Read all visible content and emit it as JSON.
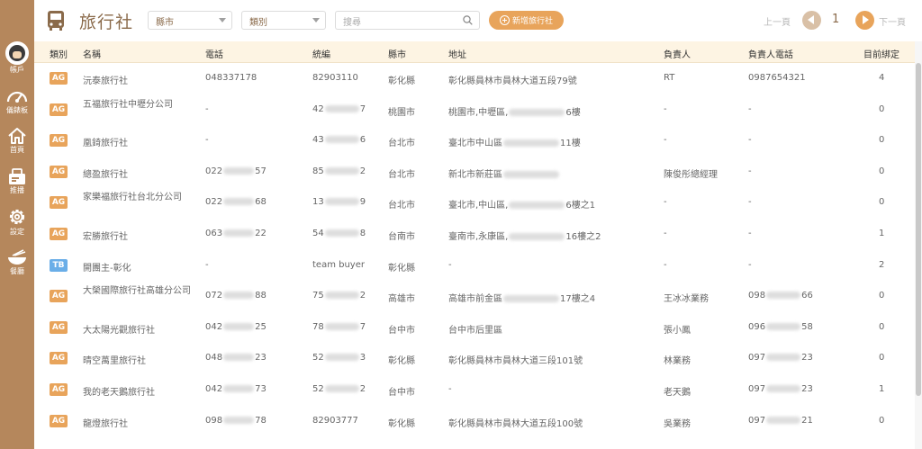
{
  "sidebar": {
    "items": [
      {
        "label": "帳戶",
        "icon": "avatar"
      },
      {
        "label": "儀錶板",
        "icon": "dashboard-icon"
      },
      {
        "label": "首頁",
        "icon": "home-icon"
      },
      {
        "label": "推播",
        "icon": "push-icon"
      },
      {
        "label": "設定",
        "icon": "gear-icon"
      },
      {
        "label": "餐廳",
        "icon": "restaurant-icon"
      }
    ]
  },
  "header": {
    "title": "旅行社",
    "county_select": "縣市",
    "category_select": "類別",
    "search_placeholder": "搜尋",
    "add_button": "新增旅行社",
    "prev_label": "上一頁",
    "page": "1",
    "next_label": "下一頁"
  },
  "table": {
    "columns": [
      "類別",
      "名稱",
      "電話",
      "統編",
      "縣市",
      "地址",
      "負責人",
      "負責人電話",
      "目前綁定"
    ],
    "rows": [
      {
        "tag": "AG",
        "name": "沅泰旅行社",
        "phone": "048337178",
        "tax": "82903110",
        "county": "彰化縣",
        "addr": "彰化縣員林市員林大道五段79號",
        "owner": "RT",
        "owner_phone": "0987654321",
        "bound": "4"
      },
      {
        "tag": "AG",
        "name": "五福旅行社中壢分公司",
        "phone": "-",
        "tax": "42",
        "tax_tail": "7",
        "county": "桃園市",
        "addr": "桃園市,中壢區,",
        "addr_tail": "6樓",
        "owner": "-",
        "owner_phone": "-",
        "bound": "0"
      },
      {
        "tag": "AG",
        "name": "凰錡旅行社",
        "phone": "-",
        "tax": "43",
        "tax_tail": "6",
        "county": "台北市",
        "addr": "臺北市中山區",
        "addr_tail": "11樓",
        "owner": "-",
        "owner_phone": "-",
        "bound": "0"
      },
      {
        "tag": "AG",
        "name": "總盈旅行社",
        "phone": "022",
        "phone_tail": "57",
        "tax": "85",
        "tax_tail": "2",
        "county": "台北市",
        "addr": "新北市新莊區",
        "addr_tail": "",
        "owner": "陳俊彤總經理",
        "owner_phone": "-",
        "bound": "0"
      },
      {
        "tag": "AG",
        "name": "家樂福旅行社台北分公司",
        "phone": "022",
        "phone_tail": "68",
        "tax": "13",
        "tax_tail": "9",
        "county": "台北市",
        "addr": "臺北市,中山區,",
        "addr_tail": "6樓之1",
        "owner": "-",
        "owner_phone": "-",
        "bound": "0"
      },
      {
        "tag": "AG",
        "name": "宏勝旅行社",
        "phone": "063",
        "phone_tail": "22",
        "tax": "54",
        "tax_tail": "8",
        "county": "台南市",
        "addr": "臺南市,永康區,",
        "addr_tail": "16樓之2",
        "owner": "-",
        "owner_phone": "-",
        "bound": "1"
      },
      {
        "tag": "TB",
        "name": "開團主-彰化",
        "phone": "-",
        "tax": "team buyer",
        "county": "彰化縣",
        "addr": "-",
        "owner": "-",
        "owner_phone": "-",
        "bound": "2"
      },
      {
        "tag": "AG",
        "name": "大榮國際旅行社高雄分公司",
        "phone": "072",
        "phone_tail": "88",
        "tax": "75",
        "tax_tail": "2",
        "county": "高雄市",
        "addr": "高雄市前金區",
        "addr_tail": "17樓之4",
        "owner": "王冰冰業務",
        "owner_phone": "098",
        "owner_phone_tail": "66",
        "bound": "0"
      },
      {
        "tag": "AG",
        "name": "大太陽光觀旅行社",
        "phone": "042",
        "phone_tail": "25",
        "tax": "78",
        "tax_tail": "7",
        "county": "台中市",
        "addr": "台中市后里區",
        "owner": "張小鳳",
        "owner_phone": "096",
        "owner_phone_tail": "58",
        "bound": "0"
      },
      {
        "tag": "AG",
        "name": "晴空萬里旅行社",
        "phone": "048",
        "phone_tail": "23",
        "tax": "52",
        "tax_tail": "3",
        "county": "彰化縣",
        "addr": "彰化縣員林市員林大道三段101號",
        "owner": "林業務",
        "owner_phone": "097",
        "owner_phone_tail": "23",
        "bound": "0"
      },
      {
        "tag": "AG",
        "name": "我的老天鵝旅行社",
        "phone": "042",
        "phone_tail": "73",
        "tax": "52",
        "tax_tail": "2",
        "county": "台中市",
        "addr": "-",
        "owner": "老天鵝",
        "owner_phone": "097",
        "owner_phone_tail": "23",
        "bound": "1"
      },
      {
        "tag": "AG",
        "name": "龍燈旅行社",
        "phone": "098",
        "phone_tail": "78",
        "tax": "82903777",
        "county": "彰化縣",
        "addr": "彰化縣員林市員林大道五段100號",
        "owner": "吳業務",
        "owner_phone": "097",
        "owner_phone_tail": "21",
        "bound": "0"
      }
    ]
  },
  "colors": {
    "sidebar": "#b5875c",
    "accent": "#e8a45b",
    "ag_tag": "#e8a45b",
    "tb_tag": "#6aaee8",
    "header_row": "#fdf4e3"
  }
}
